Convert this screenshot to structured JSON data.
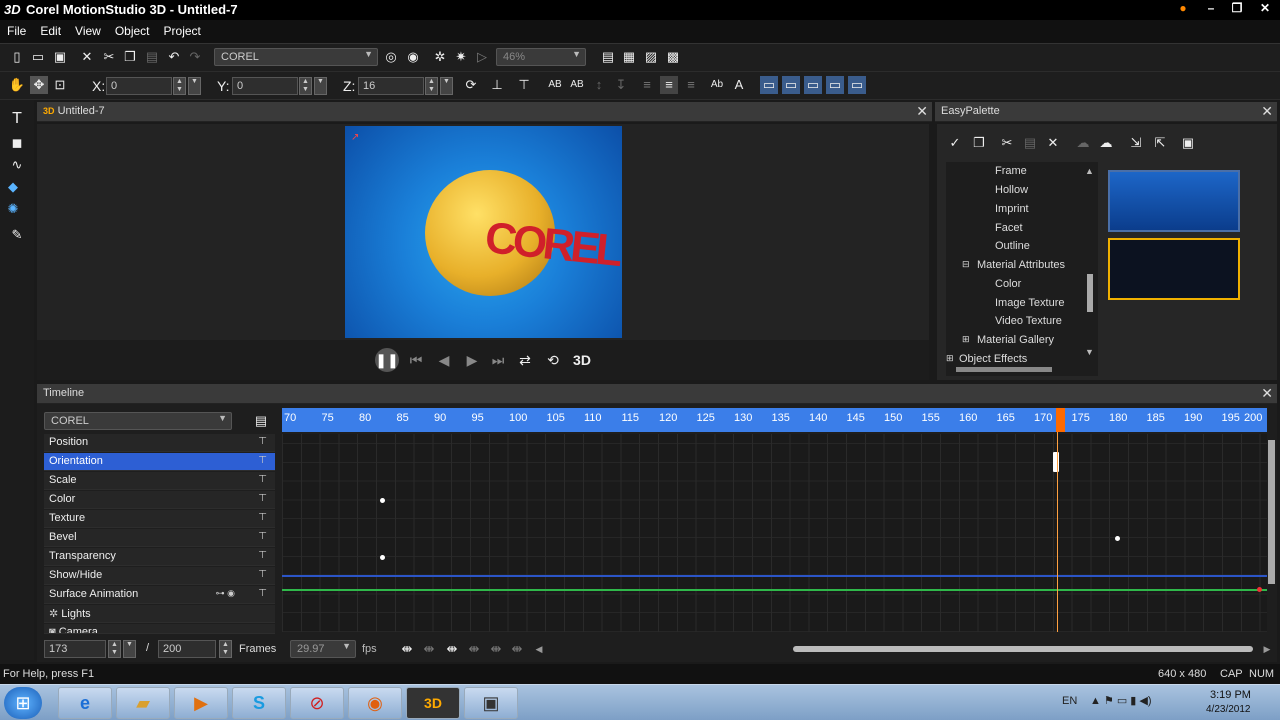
{
  "window": {
    "logo": "3D",
    "title": "Corel MotionStudio 3D - Untitled-7"
  },
  "menu": [
    "File",
    "Edit",
    "View",
    "Object",
    "Project"
  ],
  "toolbar1": {
    "font_name": "COREL",
    "zoom": "46%"
  },
  "toolbar2": {
    "x_label": "X:",
    "x_value": "0",
    "y_label": "Y:",
    "y_value": "0",
    "z_label": "Z:",
    "z_value": "16"
  },
  "viewport": {
    "title": "Untitled-7",
    "scene_text": "COREL",
    "mode_3d": "3D"
  },
  "palette": {
    "title": "EasyPalette",
    "tree": [
      "Frame",
      "Hollow",
      "Imprint",
      "Facet",
      "Outline",
      "Material Attributes",
      "Color",
      "Image Texture",
      "Video Texture",
      "Material Gallery",
      "Object Effects"
    ]
  },
  "timeline": {
    "title": "Timeline",
    "object": "COREL",
    "tracks": [
      "Position",
      "Orientation",
      "Scale",
      "Color",
      "Texture",
      "Bevel",
      "Transparency",
      "Show/Hide",
      "Surface Animation",
      "Lights",
      "Camera"
    ],
    "selected_track": "Orientation",
    "ruler": [
      "70",
      "75",
      "80",
      "85",
      "90",
      "95",
      "100",
      "105",
      "110",
      "115",
      "120",
      "125",
      "130",
      "135",
      "140",
      "145",
      "150",
      "155",
      "160",
      "165",
      "170",
      "175",
      "180",
      "185",
      "190",
      "195",
      "200"
    ],
    "current_frame": "173",
    "sep": "/",
    "total_frames": "200",
    "frames_label": "Frames",
    "fps": "29.97",
    "fps_label": "fps"
  },
  "status": {
    "help": "For Help, press F1",
    "size": "640 x 480",
    "cap": "CAP",
    "num": "NUM"
  },
  "taskbar": {
    "lang": "EN",
    "time": "3:19 PM",
    "date": "4/23/2012"
  }
}
